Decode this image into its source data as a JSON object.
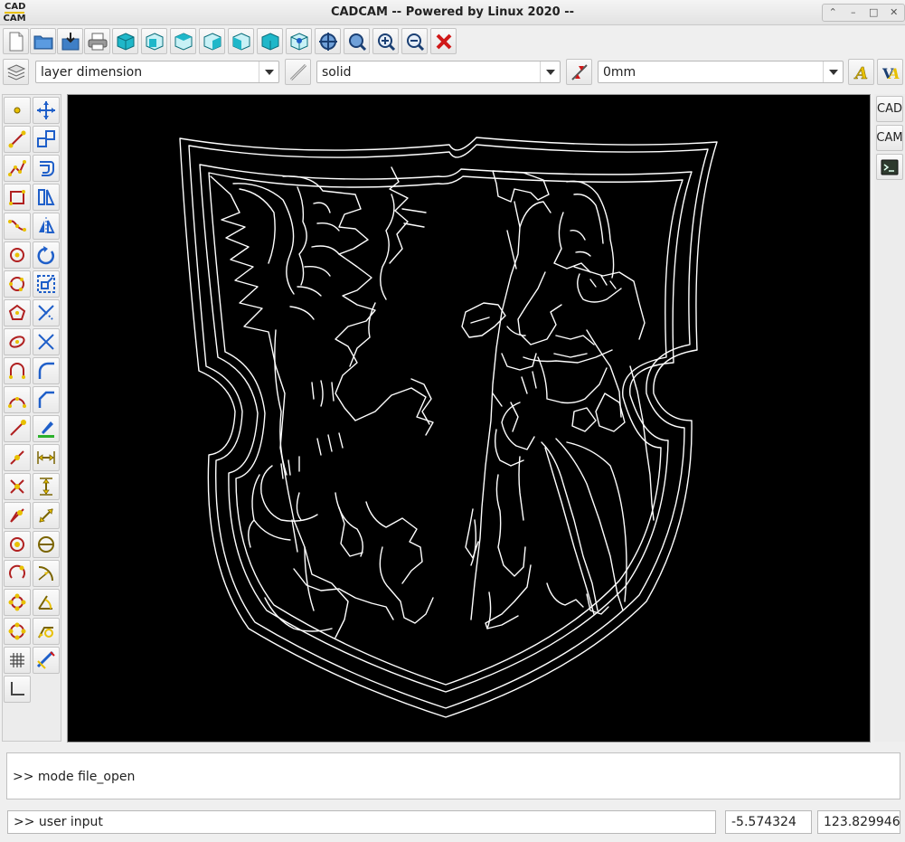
{
  "window": {
    "logo_line1": "CAD",
    "logo_line2": "CAM",
    "title": "CADCAM -- Powered by Linux 2020 --",
    "wm_buttons": [
      "⌃",
      "–",
      "□",
      "✕"
    ]
  },
  "toolbar": {
    "file_actions": [
      "new-file-icon",
      "open-file-icon",
      "import-icon",
      "print-icon"
    ],
    "view_actions": [
      "view-solid-icon",
      "view-front-icon",
      "view-top-icon",
      "view-right-icon",
      "view-left-icon",
      "view-back-icon",
      "view-iso-icon"
    ],
    "zoom_actions": [
      "zoom-extents-icon",
      "zoom-window-icon",
      "zoom-in-icon",
      "zoom-out-icon",
      "delete-icon"
    ]
  },
  "properties": {
    "layer": "layer dimension",
    "linetype": "solid",
    "linewidth": "0mm"
  },
  "left_tools": [
    [
      "point-icon",
      "move-icon"
    ],
    [
      "line-icon",
      "scale-icon"
    ],
    [
      "polyline-icon",
      "offset-icon"
    ],
    [
      "rectangle-icon",
      "mirror-icon"
    ],
    [
      "spline-icon",
      "mirror-axis-icon"
    ],
    [
      "circle-icon",
      "rotate-icon"
    ],
    [
      "circle-3p-icon",
      "stretch-icon"
    ],
    [
      "polygon-icon",
      "trim-icon"
    ],
    [
      "ellipse-icon",
      "cross-icon"
    ],
    [
      "arc-icon",
      "fillet-icon"
    ],
    [
      "arc-3p-icon",
      "chamfer-icon"
    ],
    [
      "snap-endpoint-icon",
      "layer-color-icon"
    ],
    [
      "snap-midpoint-icon",
      "dimension-horizontal-icon"
    ],
    [
      "snap-intersection-icon",
      "dimension-vertical-icon"
    ],
    [
      "snap-nearest-icon",
      "dimension-aligned-icon"
    ],
    [
      "snap-perpendicular-icon",
      "dimension-diameter-icon"
    ],
    [
      "snap-center-icon",
      "dimension-radius-icon"
    ],
    [
      "snap-tangent-icon",
      "dimension-angle-icon"
    ],
    [
      "snap-quadrant-icon",
      "dimension-leader-icon"
    ],
    [
      "grid-icon",
      "edit-text-icon"
    ],
    [
      "ortho-icon"
    ]
  ],
  "right_tabs": {
    "cad": "CAD",
    "cam": "CAM",
    "terminal": "terminal-icon"
  },
  "console": {
    "message": ">> mode file_open"
  },
  "statusbar": {
    "command_input": ">> user input",
    "coord_x": "-5.574324",
    "coord_y": "123.829946"
  },
  "colors": {
    "canvas_bg": "#000000",
    "drawing_stroke": "#ffffff",
    "view_cube": "#1fb7c9",
    "accent_yellow": "#e8c000"
  }
}
